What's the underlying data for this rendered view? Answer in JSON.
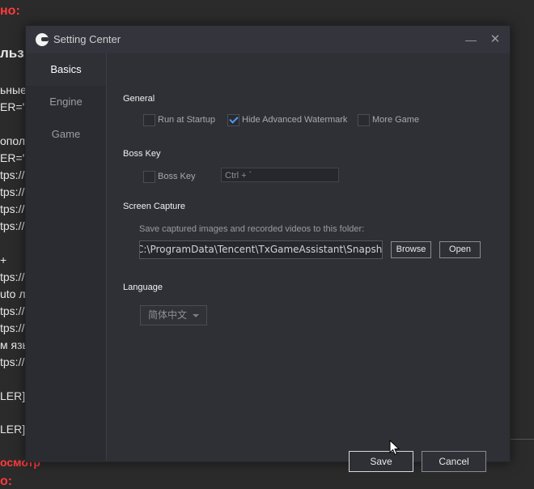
{
  "background": {
    "lines": [
      {
        "text": "но:",
        "style": "red"
      },
      {
        "text": "льз",
        "style": "big"
      },
      {
        "text": "ьные",
        "style": ""
      },
      {
        "text": "ER='",
        "style": ""
      },
      {
        "text": "ополі",
        "style": ""
      },
      {
        "text": "ER='",
        "style": ""
      },
      {
        "text": "tps://",
        "style": ""
      },
      {
        "text": "tps://",
        "style": ""
      },
      {
        "text": "tps://",
        "style": ""
      },
      {
        "text": "tps://",
        "style": ""
      },
      {
        "text": "+",
        "style": ""
      },
      {
        "text": "tps://",
        "style": ""
      },
      {
        "text": "uto л",
        "style": ""
      },
      {
        "text": "tps://",
        "style": ""
      },
      {
        "text": "tps://",
        "style": ""
      },
      {
        "text": "м язь",
        "style": ""
      },
      {
        "text": "tps://",
        "style": ""
      },
      {
        "text": "LER]",
        "style": ""
      },
      {
        "text": "LER]",
        "style": ""
      },
      {
        "text": "осмотр",
        "style": "red"
      },
      {
        "text": "о:",
        "style": "red"
      }
    ]
  },
  "window": {
    "title": "Setting Center",
    "minimize_glyph": "—",
    "close_glyph": "✕"
  },
  "sidebar": {
    "items": [
      {
        "label": "Basics",
        "active": true
      },
      {
        "label": "Engine",
        "active": false
      },
      {
        "label": "Game",
        "active": false
      }
    ]
  },
  "general": {
    "title": "General",
    "run_at_startup": {
      "label": "Run at Startup",
      "checked": false
    },
    "hide_watermark": {
      "label": "Hide Advanced Watermark",
      "checked": true
    },
    "more_game": {
      "label": "More Game",
      "checked": false
    }
  },
  "boss_key": {
    "title": "Boss Key",
    "checkbox": {
      "label": "Boss Key",
      "checked": false
    },
    "hotkey_value": "Ctrl + `"
  },
  "screen_capture": {
    "title": "Screen Capture",
    "hint": "Save captured images and recorded videos to this folder:",
    "path": "C:\\ProgramData\\Tencent\\TxGameAssistant\\Snapshot",
    "browse_label": "Browse",
    "open_label": "Open"
  },
  "language": {
    "title": "Language",
    "selected": "简体中文"
  },
  "footer": {
    "save_label": "Save",
    "cancel_label": "Cancel"
  },
  "colors": {
    "accent_check": "#4d9bf0",
    "dialog_bg": "#2f3036",
    "sidebar_bg": "#2b2c31",
    "forum_red": "#ff3a3a"
  }
}
